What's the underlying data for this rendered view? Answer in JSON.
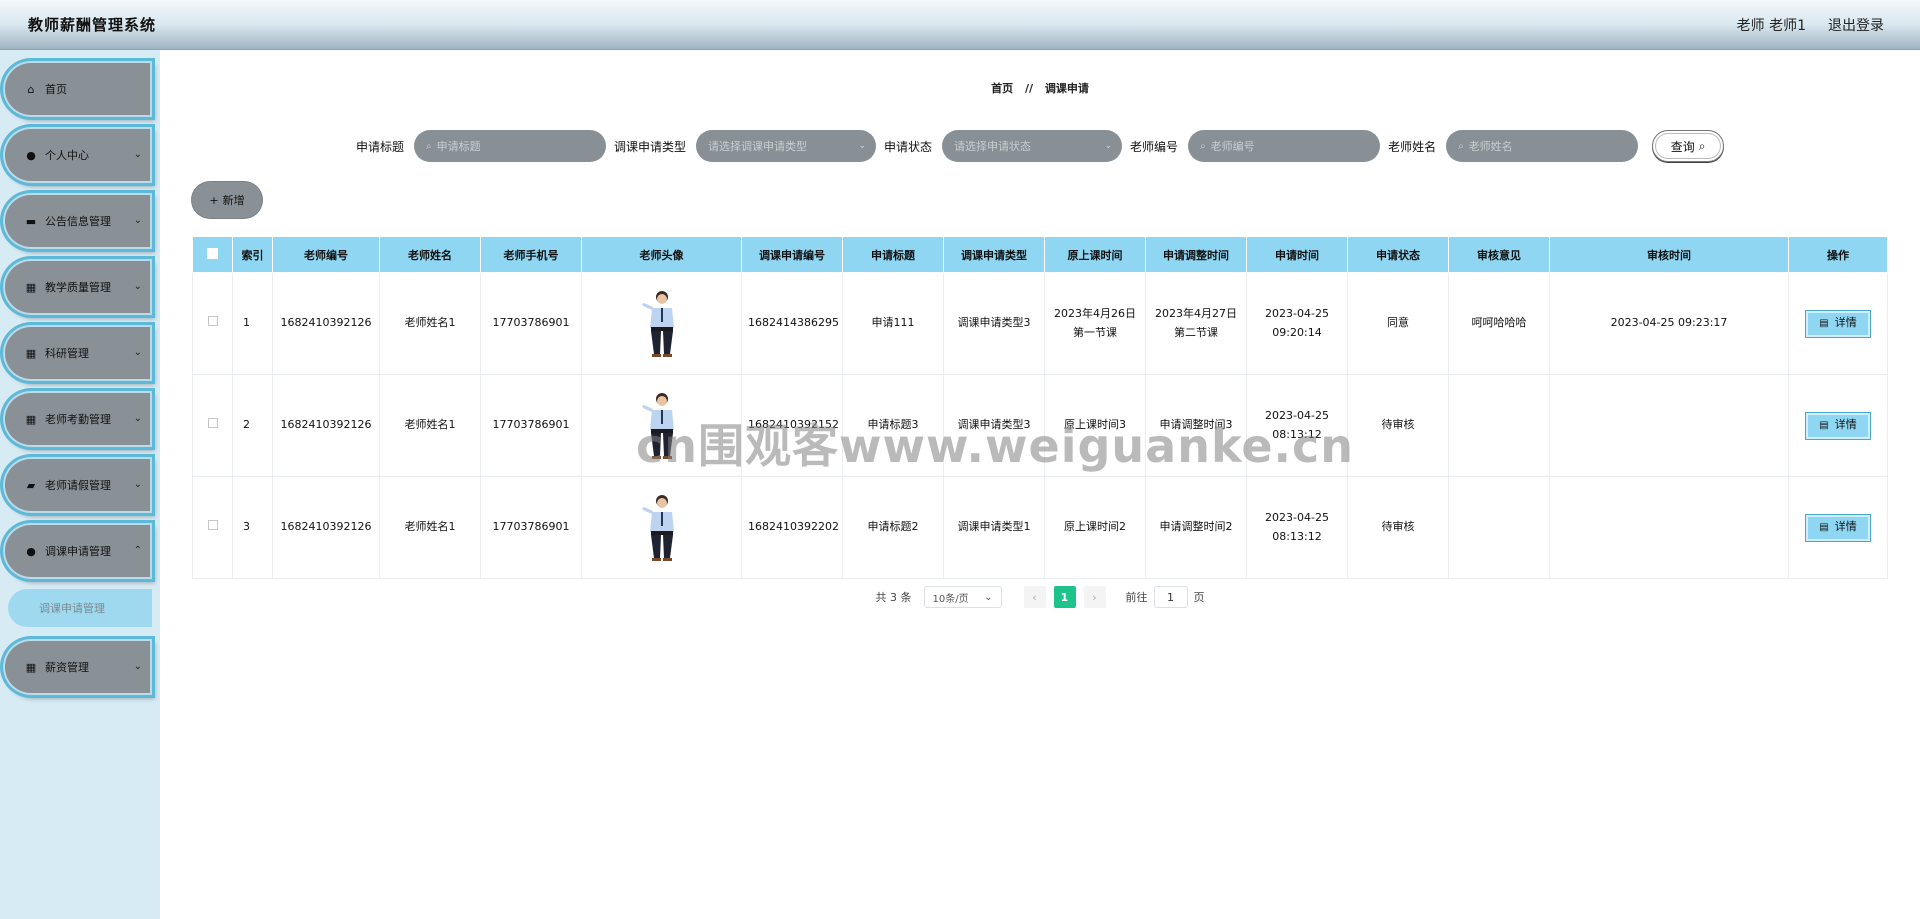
{
  "header": {
    "title": "教师薪酬管理系统",
    "user": "老师 老师1",
    "logout": "退出登录"
  },
  "sidebar": {
    "items": [
      {
        "label": "首页",
        "icon": "home-icon",
        "has_arrow": false
      },
      {
        "label": "个人中心",
        "icon": "user-icon",
        "has_arrow": true
      },
      {
        "label": "公告信息管理",
        "icon": "monitor-icon",
        "has_arrow": true
      },
      {
        "label": "教学质量管理",
        "icon": "grid-icon",
        "has_arrow": true
      },
      {
        "label": "科研管理",
        "icon": "grid-icon",
        "has_arrow": true
      },
      {
        "label": "老师考勤管理",
        "icon": "grid-icon",
        "has_arrow": true
      },
      {
        "label": "老师请假管理",
        "icon": "briefcase-icon",
        "has_arrow": true
      },
      {
        "label": "调课申请管理",
        "icon": "user-icon",
        "has_arrow": true
      },
      {
        "label": "薪资管理",
        "icon": "grid-icon",
        "has_arrow": true
      }
    ],
    "active_subitem": "调课申请管理"
  },
  "breadcrumb": {
    "home": "首页",
    "separator": "//",
    "current": "调课申请"
  },
  "search": {
    "title_label": "申请标题",
    "title_placeholder": "申请标题",
    "type_label": "调课申请类型",
    "type_placeholder": "请选择调课申请类型",
    "status_label": "申请状态",
    "status_placeholder": "请选择申请状态",
    "teacher_no_label": "老师编号",
    "teacher_no_placeholder": "老师编号",
    "teacher_name_label": "老师姓名",
    "teacher_name_placeholder": "老师姓名",
    "query_button": "查询"
  },
  "toolbar": {
    "add_button": "新增"
  },
  "table": {
    "columns": [
      "索引",
      "老师编号",
      "老师姓名",
      "老师手机号",
      "老师头像",
      "调课申请编号",
      "申请标题",
      "调课申请类型",
      "原上课时间",
      "申请调整时间",
      "申请时间",
      "申请状态",
      "审核意见",
      "审核时间",
      "操作"
    ],
    "rows": [
      {
        "index": "1",
        "teacher_no": "1682410392126",
        "teacher_name": "老师姓名1",
        "phone": "17703786901",
        "apply_no": "1682414386295",
        "title": "申请111",
        "type": "调课申请类型3",
        "original_time": "2023年4月26日 第一节课",
        "adjust_time": "2023年4月27日 第二节课",
        "apply_time": "2023-04-25 09:20:14",
        "status": "同意",
        "opinion": "呵呵哈哈哈",
        "review_time": "2023-04-25 09:23:17"
      },
      {
        "index": "2",
        "teacher_no": "1682410392126",
        "teacher_name": "老师姓名1",
        "phone": "17703786901",
        "apply_no": "1682410392152",
        "title": "申请标题3",
        "type": "调课申请类型3",
        "original_time": "原上课时间3",
        "adjust_time": "申请调整时间3",
        "apply_time": "2023-04-25 08:13:12",
        "status": "待审核",
        "opinion": "",
        "review_time": ""
      },
      {
        "index": "3",
        "teacher_no": "1682410392126",
        "teacher_name": "老师姓名1",
        "phone": "17703786901",
        "apply_no": "1682410392202",
        "title": "申请标题2",
        "type": "调课申请类型1",
        "original_time": "原上课时间2",
        "adjust_time": "申请调整时间2",
        "apply_time": "2023-04-25 08:13:12",
        "status": "待审核",
        "opinion": "",
        "review_time": ""
      }
    ],
    "detail_button": "详情"
  },
  "pagination": {
    "total": "共 3 条",
    "page_size": "10条/页",
    "prev": "‹",
    "current_page": "1",
    "next": "›",
    "goto_label": "前往",
    "goto_value": "1",
    "goto_suffix": "页"
  },
  "watermark": "cn围观客www.weiguanke.cn"
}
